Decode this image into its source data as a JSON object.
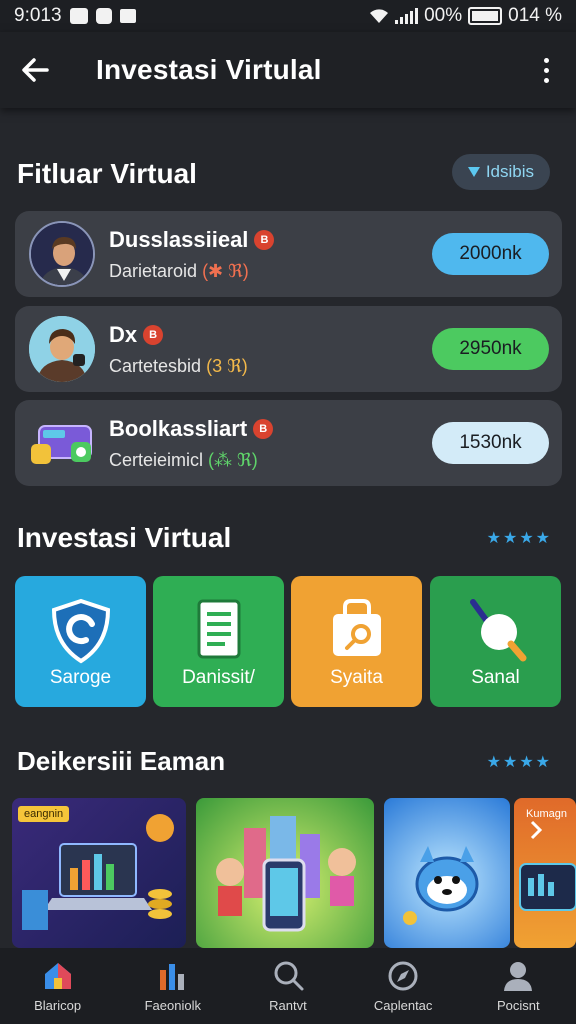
{
  "status_bar": {
    "time": "9:013",
    "battery_pct": "00%",
    "right_time": "014 %"
  },
  "app_bar": {
    "title": "Investasi Virtulal",
    "back_icon": "arrow-left-icon",
    "menu_icon": "more-vertical-icon"
  },
  "featured": {
    "title": "Fitluar Virtual",
    "filter_label": "Idsibis",
    "items": [
      {
        "name": "Dusslassiieal",
        "subtitle": "Darietaroid",
        "subtitle_accent": "(✱ ℜ)",
        "amount": "2000nk",
        "amount_color": "#4fb8ee"
      },
      {
        "name": "Dx",
        "subtitle": "Cartetesbid",
        "subtitle_accent": "(3 ℜ)",
        "amount": "2950nk",
        "amount_color": "#4cca60"
      },
      {
        "name": "Boolkassliart",
        "subtitle": "Certeieimicl",
        "subtitle_accent": "(⁂ ℜ)",
        "amount": "1530nk",
        "amount_color": "#d3ebf8"
      }
    ]
  },
  "categories": {
    "title": "Investasi Virtual",
    "stars": "★★★★",
    "items": [
      {
        "label": "Saroge",
        "color": "#27a9de",
        "icon": "shield-icon"
      },
      {
        "label": "Danissit/",
        "color": "#2fae54",
        "icon": "document-icon"
      },
      {
        "label": "Syaita",
        "color": "#f0a233",
        "icon": "shopping-bag-icon"
      },
      {
        "label": "Sanal",
        "color": "#2a9e4e",
        "icon": "lollipop-icon"
      }
    ]
  },
  "promos": {
    "title": "Deikersiii Eaman",
    "stars": "★★★★",
    "items": [
      {
        "tag": "eangnin",
        "icon": "finance-laptop-icon"
      },
      {
        "tag": "",
        "icon": "city-phone-icon"
      },
      {
        "tag": "",
        "icon": "mascot-icon"
      },
      {
        "tag": "Kumagn",
        "icon": "chevron-right-icon"
      }
    ]
  },
  "bottom_nav": [
    {
      "label": "Blaricop",
      "icon": "home-icon"
    },
    {
      "label": "Faeoniolk",
      "icon": "bar-chart-icon"
    },
    {
      "label": "Rantvt",
      "icon": "search-icon"
    },
    {
      "label": "Caplentac",
      "icon": "compass-icon"
    },
    {
      "label": "Pocisnt",
      "icon": "profile-icon"
    }
  ]
}
